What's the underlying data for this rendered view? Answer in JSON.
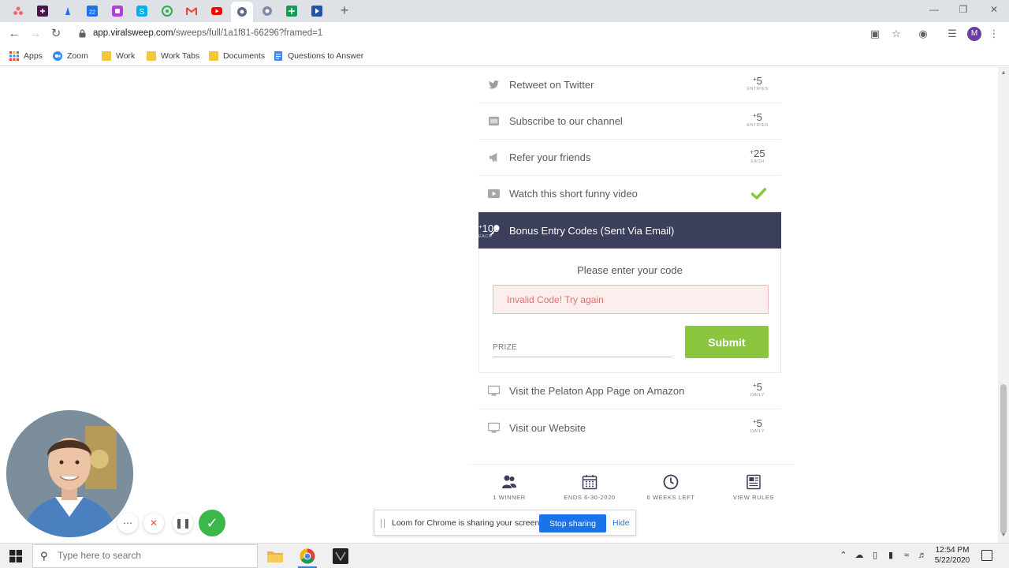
{
  "browser": {
    "url_host": "app.viralsweep.com",
    "url_path": "/sweeps/full/1a1f81-66296?framed=1",
    "profile_initial": "M",
    "tabs": [
      {
        "icon": "asana-icon",
        "color": "#f06a6a"
      },
      {
        "icon": "slack-icon",
        "color": "#4a154b"
      },
      {
        "icon": "pin-icon",
        "color": "#1a73e8"
      },
      {
        "icon": "calendar-icon",
        "color": "#1a73e8",
        "text": "22"
      },
      {
        "icon": "app-icon",
        "color": "#b03ee0"
      },
      {
        "icon": "skype-icon",
        "color": "#00aff0"
      },
      {
        "icon": "chrome-app-icon",
        "color": "#34a853"
      },
      {
        "icon": "gmail-icon",
        "color": "#ea4335"
      },
      {
        "icon": "youtube-icon",
        "color": "#ff0000"
      },
      {
        "icon": "viralsweep-icon",
        "color": "#5b6b8c",
        "active": true
      },
      {
        "icon": "viralsweep-icon",
        "color": "#7d8cab"
      },
      {
        "icon": "sheets-icon",
        "color": "#0f9d58"
      },
      {
        "icon": "play-icon",
        "color": "#2154a6"
      }
    ]
  },
  "bookmarks": {
    "items": [
      {
        "label": "Apps",
        "icon": "apps-grid-icon"
      },
      {
        "label": "Zoom",
        "icon": "zoom-icon"
      },
      {
        "label": "Work",
        "icon": "folder-icon"
      },
      {
        "label": "Work Tabs",
        "icon": "folder-icon"
      },
      {
        "label": "Documents",
        "icon": "folder-icon"
      },
      {
        "label": "Questions to Answer",
        "icon": "doc-icon"
      }
    ]
  },
  "entries": [
    {
      "label": "Retweet on Twitter",
      "icon": "twitter-icon",
      "points": "5",
      "unit": "ENTRIES"
    },
    {
      "label": "Subscribe to our channel",
      "icon": "youtube-icon",
      "points": "5",
      "unit": "ENTRIES"
    },
    {
      "label": "Refer your friends",
      "icon": "megaphone-icon",
      "points": "25",
      "unit": "EACH"
    },
    {
      "label": "Watch this short funny video",
      "icon": "video-icon",
      "completed": true
    }
  ],
  "bonus": {
    "label": "Bonus Entry Codes (Sent Via Email)",
    "points": "100",
    "unit": "EACH",
    "prompt": "Please enter your code",
    "error": "Invalid Code! Try again",
    "code_value": "PRIZE",
    "submit_label": "Submit"
  },
  "entries_after": [
    {
      "label": "Visit the Pelaton App Page on Amazon",
      "icon": "monitor-icon",
      "points": "5",
      "unit": "DAILY"
    },
    {
      "label": "Visit our Website",
      "icon": "monitor-icon",
      "points": "5",
      "unit": "DAILY"
    }
  ],
  "footer": [
    {
      "label": "1 WINNER",
      "icon": "users-icon"
    },
    {
      "label": "ENDS 6-30-2020",
      "icon": "calendar-icon"
    },
    {
      "label": "6 WEEKS LEFT",
      "icon": "clock-icon"
    },
    {
      "label": "VIEW RULES",
      "icon": "rules-icon"
    }
  ],
  "share_bar": {
    "message": "Loom for Chrome is sharing your screen.",
    "stop_label": "Stop sharing",
    "hide_label": "Hide"
  },
  "taskbar": {
    "search_placeholder": "Type here to search",
    "time": "12:54 PM",
    "date": "5/22/2020"
  },
  "colors": {
    "bonus_header": "#3b3f5c",
    "submit": "#8cc63f",
    "check": "#8cc63f",
    "error_bg": "#fdeeee",
    "error_text": "#e27070",
    "share_button": "#1a73e8"
  }
}
